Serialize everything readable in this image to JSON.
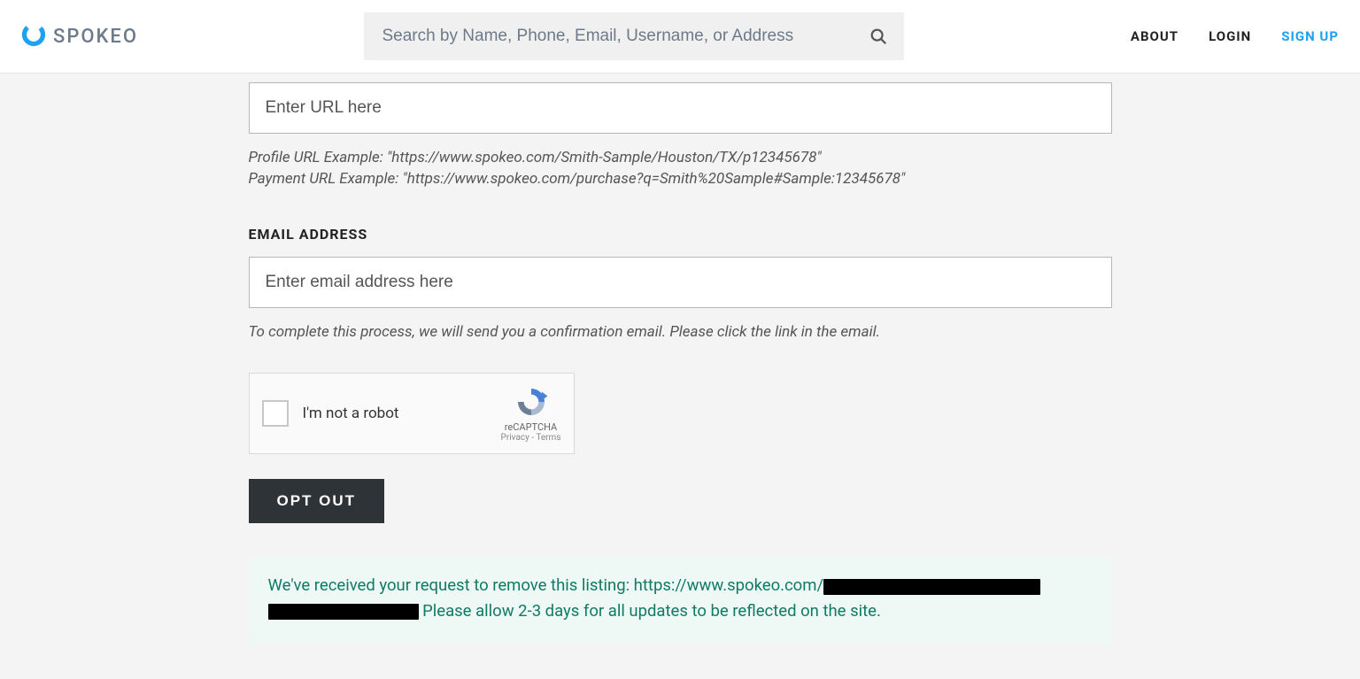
{
  "brand": {
    "name": "SPOKEO"
  },
  "search": {
    "placeholder": "Search by Name, Phone, Email, Username, or Address"
  },
  "nav": {
    "about": "ABOUT",
    "login": "LOGIN",
    "signup": "SIGN UP"
  },
  "form": {
    "url_field": {
      "placeholder": "Enter URL here"
    },
    "url_help_1": "Profile URL Example: \"https://www.spokeo.com/Smith-Sample/Houston/TX/p12345678\"",
    "url_help_2": "Payment URL Example: \"https://www.spokeo.com/purchase?q=Smith%20Sample#Sample:12345678\"",
    "email_label": "EMAIL ADDRESS",
    "email_field": {
      "placeholder": "Enter email address here"
    },
    "email_help": "To complete this process, we will send you a confirmation email. Please click the link in the email.",
    "optout_label": "OPT OUT"
  },
  "recaptcha": {
    "label": "I'm not a robot",
    "brand": "reCAPTCHA",
    "links": "Privacy - Terms"
  },
  "confirmation": {
    "part1": "We've received your request to remove this listing: https://www.spokeo.com/",
    "part2": " Please allow 2-3 days for all updates to be reflected on the site."
  }
}
